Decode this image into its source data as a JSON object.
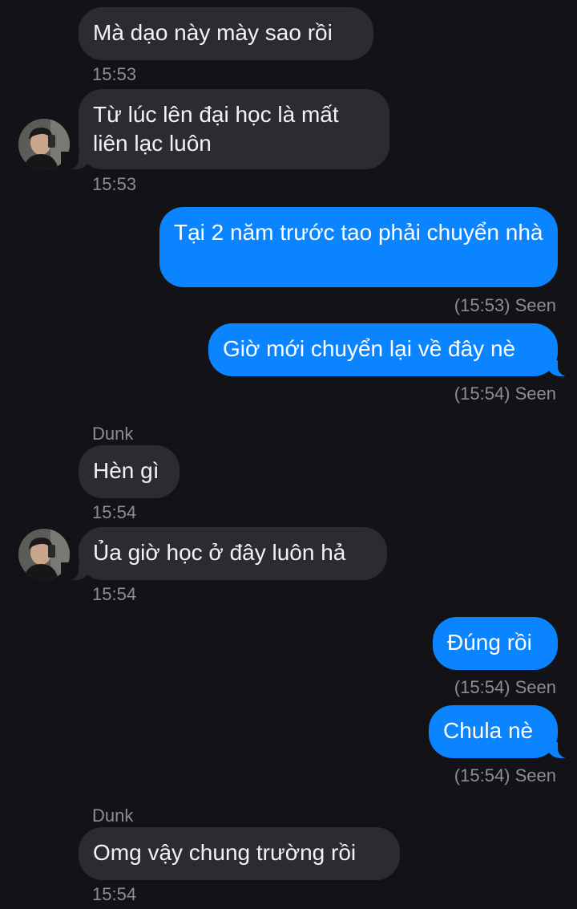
{
  "messages": [
    {
      "direction": "in",
      "text": "Mà dạo này mày sao rồi",
      "time": "15:53"
    },
    {
      "direction": "in",
      "text": "Từ lúc lên đại học là mất liên lạc luôn",
      "time": "15:53"
    },
    {
      "direction": "out",
      "text": "Tại 2 năm trước tao phải chuyển nhà",
      "status": "(15:53) Seen"
    },
    {
      "direction": "out",
      "text": "Giờ mới chuyển lại về đây nè",
      "status": "(15:54) Seen"
    },
    {
      "direction": "in",
      "sender": "Dunk",
      "text": "Hèn gì",
      "time": "15:54"
    },
    {
      "direction": "in",
      "text": "Ủa giờ học ở đây luôn hả",
      "time": "15:54"
    },
    {
      "direction": "out",
      "text": "Đúng rồi",
      "status": "(15:54) Seen"
    },
    {
      "direction": "out",
      "text": "Chula nè",
      "status": "(15:54) Seen"
    },
    {
      "direction": "in",
      "sender": "Dunk",
      "text": "Omg vậy chung trường rồi",
      "time": "15:54"
    }
  ],
  "icons": {
    "avatar": "contact-avatar-photo"
  },
  "colors": {
    "background": "#131217",
    "incoming_bubble": "#2b2b30",
    "outgoing_bubble": "#0a84ff",
    "meta_text": "#8d8d93"
  }
}
